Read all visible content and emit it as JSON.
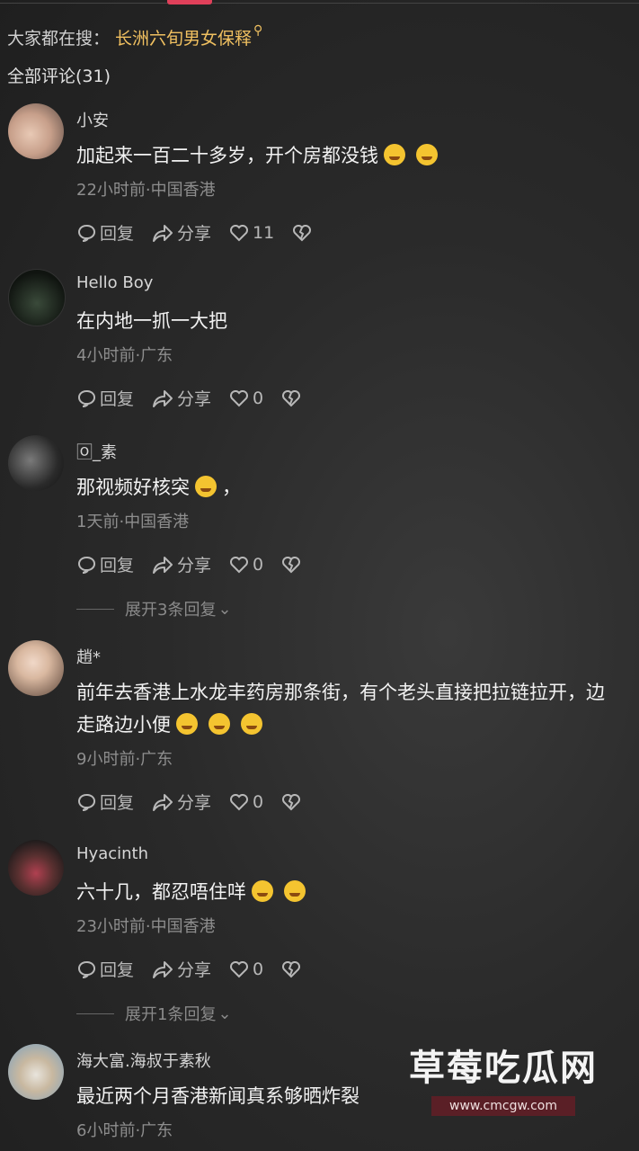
{
  "search": {
    "prefix": "大家都在搜：",
    "term": "长洲六旬男女保释"
  },
  "comments_count": "全部评论(31)",
  "labels": {
    "reply": "回复",
    "share": "分享"
  },
  "comments": [
    {
      "name": "小安",
      "text": "加起来一百二十多岁，开个房都没钱",
      "meta": "22小时前·中国香港",
      "likes": "11"
    },
    {
      "name": "Hello Boy",
      "text": "在内地一抓一大把",
      "meta": "4小时前·广东",
      "likes": "0"
    },
    {
      "name": "🄾_素",
      "text": "那视频好核突",
      "text_suffix": "，",
      "meta": "1天前·中国香港",
      "likes": "0",
      "expand": "展开3条回复"
    },
    {
      "name": "趙*",
      "text": "前年去香港上水龙丰药房那条街，有个老头直接把拉链拉开，边走路边小便",
      "meta": "9小时前·广东",
      "likes": "0"
    },
    {
      "name": "Hyacinth",
      "text": "六十几，都忍唔住咩",
      "meta": "23小时前·中国香港",
      "likes": "0",
      "expand": "展开1条回复"
    },
    {
      "name": "海大富.海叔于素秋",
      "text": "最近两个月香港新闻真系够晒炸裂",
      "meta": "6小时前·广东"
    }
  ],
  "watermark": {
    "title": "草莓吃瓜网",
    "url": "www.cmcgw.com"
  },
  "colors": {
    "accent": "#e0405a",
    "search_highlight": "#f0c060"
  }
}
